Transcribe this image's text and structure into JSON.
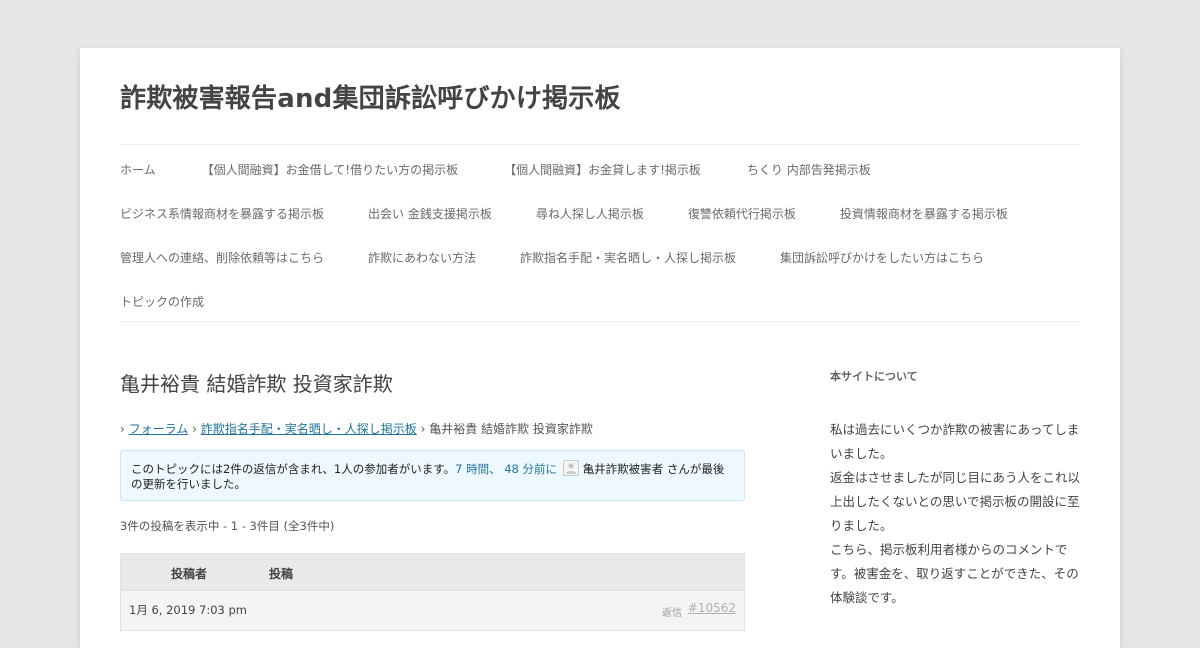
{
  "site": {
    "title": "詐欺被害報告and集団訴訟呼びかけ掲示板"
  },
  "nav": {
    "row1": [
      "ホーム",
      "【個人間融資】お金借して!借りたい方の掲示板",
      "【個人間融資】お金貸します!掲示板",
      "ちくり 内部告発掲示板"
    ],
    "row2": [
      "ビジネス系情報商材を暴露する掲示板",
      "出会い 金銭支援掲示板",
      "尋ね人探し人掲示板",
      "復讐依頼代行掲示板",
      "投資情報商材を暴露する掲示板"
    ],
    "row3": [
      "管理人への連絡、削除依頼等はこちら",
      "詐欺にあわない方法",
      "詐欺指名手配・実名晒し・人探し掲示板",
      "集団訴訟呼びかけをしたい方はこちら"
    ],
    "row4": [
      "トピックの作成"
    ]
  },
  "topic": {
    "title": "亀井裕貴 結婚詐欺 投資家詐欺",
    "breadcrumb": {
      "sep": "›",
      "forum": "フォーラム",
      "board": "詐欺指名手配・実名晒し・人探し掲示板",
      "current": "亀井裕貴 結婚詐欺 投資家詐欺"
    },
    "notice": {
      "lead": "このトピックには2件の返信が含まれ、1人の参加者がいます。",
      "time": "7 時間、 48 分前に",
      "user": "亀井詐欺被害者",
      "tail": " さんが最後の更新を行いました。"
    },
    "count": "3件の投稿を表示中 - 1 - 3件目 (全3件中)",
    "table": {
      "col_author": "投稿者",
      "col_post": "投稿"
    },
    "post": {
      "date": "1月 6, 2019 7:03 pm",
      "reply": "返信",
      "permalink": "#10562"
    }
  },
  "sidebar": {
    "title": "本サイトについて",
    "p1": "私は過去にいくつか詐欺の被害にあってしまいました。",
    "p2": "返金はさせましたが同じ目にあう人をこれ以上出したくないとの思いで掲示板の開設に至りました。",
    "p3": "こちら、掲示板利用者様からのコメントです。被害金を、取り返すことができた、その体験談です。"
  },
  "colors": {
    "background": "#e6e6e6",
    "link": "#21759b",
    "notice_bg": "#eef8ff"
  }
}
